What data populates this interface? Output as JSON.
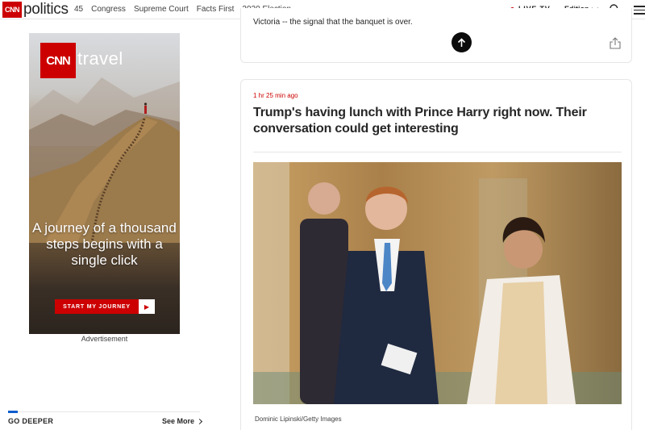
{
  "header": {
    "logo_text": "CNN",
    "section": "politics",
    "nav": [
      "45",
      "Congress",
      "Supreme Court",
      "Facts First",
      "2020 Election"
    ],
    "live_tv": "LIVE TV",
    "edition": "Edition",
    "icons": [
      "search-icon",
      "menu-icon"
    ],
    "accent_color": "#cc0000"
  },
  "ad": {
    "logo_text": "CNN",
    "brand": "travel",
    "headline": "A journey of a thousand steps begins with a single click",
    "cta_label": "START MY JOURNEY",
    "cta_arrow": "▶",
    "label": "Advertisement"
  },
  "go_deeper": {
    "title": "GO DEEPER",
    "see_more": "See More",
    "accent_color": "#0c5ccc"
  },
  "previous_post": {
    "text_tail": "Victoria -- the signal that the banquet is over."
  },
  "post": {
    "timestamp": "1 hr 25 min ago",
    "headline": "Trump's having lunch with Prince Harry right now. Their conversation could get interesting",
    "photo_credit": "Dominic Lipinski/Getty Images"
  }
}
